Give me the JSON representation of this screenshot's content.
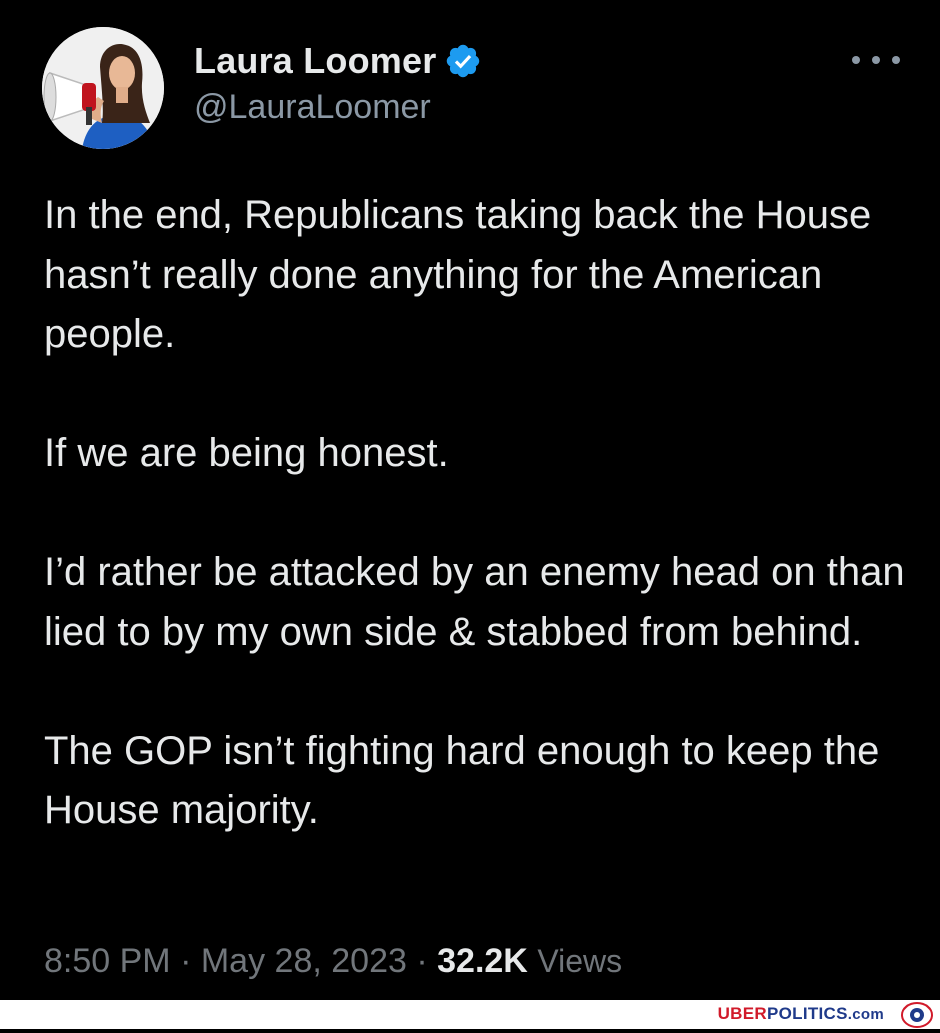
{
  "author": {
    "display_name": "Laura Loomer",
    "handle": "@LauraLoomer",
    "verified_icon": "verified-badge-icon",
    "verified_color": "#1d9bf0"
  },
  "tweet": {
    "paragraphs": [
      "In the end, Republicans taking back the House hasn’t really done anything for the American people.",
      "If we are being honest.",
      "I’d rather be attacked by an enemy head on than lied to by my own side & stabbed from behind.",
      "The GOP isn’t fighting hard enough to keep the House majority."
    ],
    "time": "8:50 PM",
    "separator": "·",
    "date": "May 28, 2023",
    "views_count": "32.2K",
    "views_label": "Views"
  },
  "watermark": {
    "part1": "UBER",
    "part2": "POLITICS",
    "part3": ".com"
  },
  "colors": {
    "background": "#000000",
    "text_primary": "#e7e9ea",
    "text_secondary": "#71767b",
    "brand_red": "#d11a2a",
    "brand_blue": "#1f3a8a"
  }
}
